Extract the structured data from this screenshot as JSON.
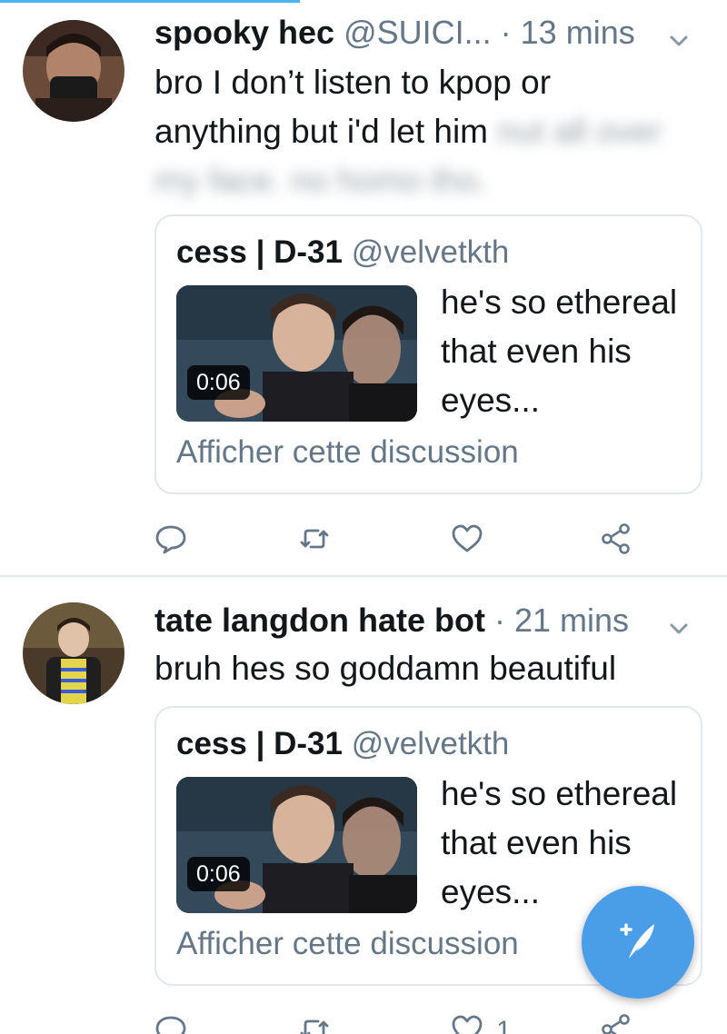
{
  "colors": {
    "accent": "#1da1f2",
    "fab": "#4a9ee8",
    "text_primary": "#14171a",
    "text_secondary": "#657786",
    "border": "#e1e8ed"
  },
  "tweets": [
    {
      "author_name": "spooky hec",
      "author_handle": "@SUICI...",
      "time": "· 13 mins",
      "text_visible": "bro I don’t listen to kpop or anything but i'd let him",
      "text_blurred": "nut all over my face. no homo tho.",
      "quote": {
        "author_name": "cess | D-31",
        "author_handle": "@velvetkth",
        "video_duration": "0:06",
        "text": "he's so ethereal that even his eyes...",
        "link": "Afficher cette discussion"
      },
      "actions": {
        "reply_icon": "reply-icon",
        "retweet_icon": "retweet-icon",
        "like_icon": "like-icon",
        "like_count": "",
        "share_icon": "share-icon"
      }
    },
    {
      "author_name": "tate langdon hate bot",
      "author_handle": "",
      "time": "· 21 mins",
      "text_visible": "bruh hes so goddamn beautiful",
      "text_blurred": "",
      "quote": {
        "author_name": "cess | D-31",
        "author_handle": "@velvetkth",
        "video_duration": "0:06",
        "text": "he's so ethereal that even his eyes...",
        "link": "Afficher cette discussion"
      },
      "actions": {
        "reply_icon": "reply-icon",
        "retweet_icon": "retweet-icon",
        "like_icon": "like-icon",
        "like_count": "1",
        "share_icon": "share-icon"
      }
    }
  ],
  "compose_button_icon": "compose-tweet-icon"
}
